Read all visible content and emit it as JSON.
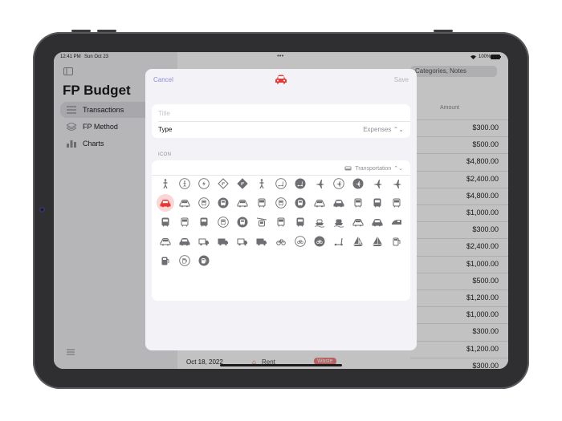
{
  "status_bar": {
    "time": "12:41 PM",
    "date": "Sun Oct 23",
    "dots": "•••",
    "battery": "100%"
  },
  "sidebar": {
    "title": "FP Budget",
    "items": [
      {
        "label": "Transactions",
        "icon": "list-icon",
        "selected": true
      },
      {
        "label": "FP Method",
        "icon": "layers-icon",
        "selected": false
      },
      {
        "label": "Charts",
        "icon": "chart-icon",
        "selected": false
      }
    ]
  },
  "main": {
    "search_placeholder": "Categories, Notes",
    "amount_header": "Amount",
    "amounts": [
      "$300.00",
      "$500.00",
      "$4,800.00",
      "$2,400.00",
      "$4,800.00",
      "$1,000.00",
      "$300.00",
      "$2,400.00",
      "$1,000.00",
      "$500.00",
      "$1,200.00",
      "$1,000.00",
      "$300.00",
      "$1,200.00",
      "$300.00"
    ],
    "bottom_row": {
      "date": "Oct 18, 2022",
      "category": "Rent",
      "badge": "Waste"
    }
  },
  "modal": {
    "cancel_label": "Cancel",
    "save_label": "Save",
    "title_placeholder": "Title",
    "type_label": "Type",
    "type_value": "Expenses",
    "icon_section_header": "ICON",
    "category_value": "Transportation",
    "accent_color": "#8e8cd8",
    "selected_icon_color": "#e53935",
    "icons": [
      "figure-walk-icon",
      "figure-walk-circle-icon",
      "bolt-circle-icon",
      "road-sign-icon",
      "road-sign-filled-icon",
      "figure-stand-icon",
      "scooter-circle-icon",
      "scooter-circle-filled-icon",
      "airplane-icon",
      "airplane-circle-icon",
      "airplane-circle-filled-icon",
      "airplane-departure-icon",
      "airplane-arrival-icon",
      "car-icon",
      "car-side-icon",
      "car-circle-icon",
      "car-circle-filled-icon",
      "car-convertible-icon",
      "bus-front-icon",
      "bus-circle-icon",
      "bus-circle-filled-icon",
      "suv-icon",
      "suv-filled-icon",
      "bus-icon",
      "bus-filled-icon",
      "tram-front-icon",
      "tram-filled-icon",
      "train-icon",
      "train-filled-icon",
      "tram-circle-icon",
      "tram-circle-filled-icon",
      "cablecar-icon",
      "tram-alt-icon",
      "tram-alt-filled-icon",
      "ferry-icon",
      "ferry-filled-icon",
      "train-side-icon",
      "train-side-filled-icon",
      "train-speed-icon",
      "bus-side-icon",
      "bus-side-filled-icon",
      "truck-box-icon",
      "truck-box-filled-icon",
      "truck-badge-icon",
      "truck-badge-filled-icon",
      "bicycle-icon",
      "bicycle-circle-icon",
      "bicycle-circle-filled-icon",
      "scooter-icon",
      "sailboat-icon",
      "sailboat-filled-icon",
      "fuelpump-icon",
      "fuelpump-filled-icon",
      "fuelpump-circle-icon",
      "fuelpump-circle-filled-icon"
    ]
  }
}
